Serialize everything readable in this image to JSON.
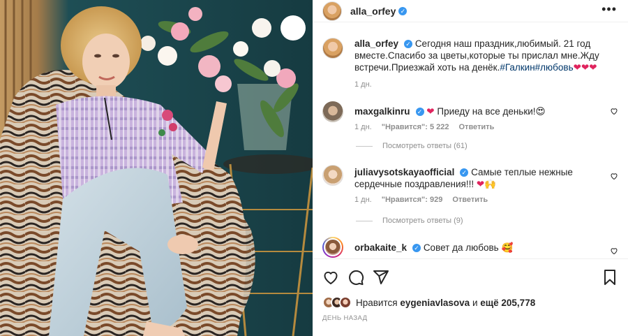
{
  "post": {
    "author": "alla_orfey",
    "caption": "Сегодня наш праздник,любимый. 21 год вместе.Спасибо за цветы,которые ты прислал мне.Жду встречи.Приезжай хоть на денёк.",
    "caption_tags": "#Галкин#любовь",
    "caption_emoji": "❤❤❤",
    "caption_time": "1 дн."
  },
  "comments": [
    {
      "username": "maxgalkinru",
      "text": "Приеду на все деньки!",
      "emoji_before": "❤",
      "emoji_after": "😍",
      "time": "1 дн.",
      "likes": "\"Нравится\": 5 222",
      "reply": "Ответить",
      "view_replies": "Посмотреть ответы (61)"
    },
    {
      "username": "juliavysotskayaofficial",
      "text": "Самые теплые нежные сердечные поздравления!!!",
      "emoji_after": "❤🙌",
      "time": "1 дн.",
      "likes": "\"Нравится\": 929",
      "reply": "Ответить",
      "view_replies": "Посмотреть ответы (9)"
    },
    {
      "username": "orbakaite_k",
      "text": "Совет да любовь",
      "emoji_after": "🥰"
    }
  ],
  "likes": {
    "prefix": "Нравится",
    "user": "eygeniavlasova",
    "middle": "и",
    "count": "ещё 205,778"
  },
  "timestamp": "ДЕНЬ НАЗАД",
  "icons": [
    "heart-icon",
    "comment-icon",
    "share-icon",
    "bookmark-icon",
    "more-icon",
    "verified-icon"
  ],
  "colors": {
    "verified": "#3897f0",
    "like_red": "#e0245e",
    "tag_link": "#00376b",
    "muted": "#8e8e8e"
  }
}
